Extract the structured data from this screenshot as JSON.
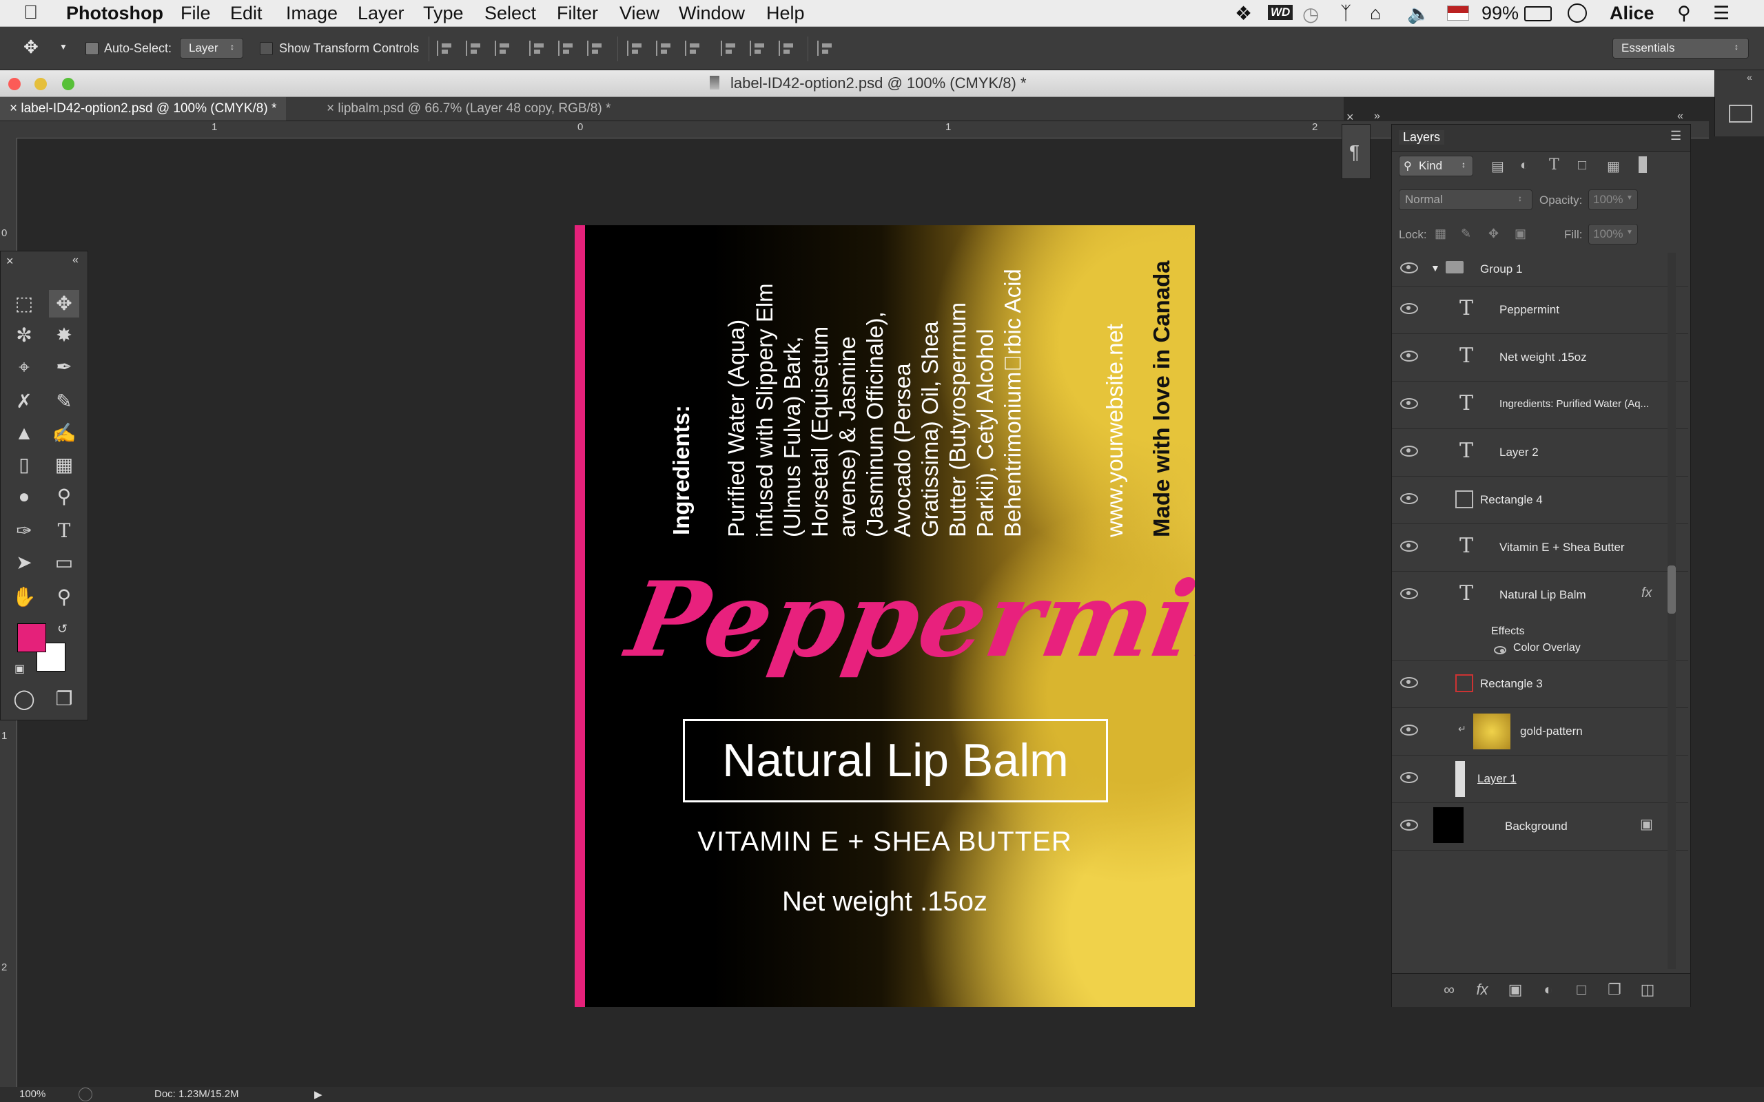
{
  "menubar": {
    "app": "Photoshop",
    "items": [
      "File",
      "Edit",
      "Image",
      "Layer",
      "Type",
      "Select",
      "Filter",
      "View",
      "Window",
      "Help"
    ],
    "wd_label": "WD",
    "battery": "99%",
    "user": "Alice"
  },
  "options": {
    "auto_select_label": "Auto-Select:",
    "auto_select_value": "Layer",
    "transform_label": "Show Transform Controls",
    "workspace": "Essentials"
  },
  "window": {
    "title": "label-ID42-option2.psd @ 100% (CMYK/8) *",
    "tabs": [
      "label-ID42-option2.psd @ 100% (CMYK/8) *",
      "lipbalm.psd @ 66.7% (Layer 48 copy, RGB/8) *"
    ]
  },
  "rulers": {
    "top": [
      "1",
      "0",
      "1",
      "2"
    ],
    "left": [
      "0",
      "1",
      "2"
    ]
  },
  "colors": {
    "foreground": "#e5217a",
    "background": "#ffffff"
  },
  "label": {
    "ingredients_heading": "Ingredients:",
    "ingredients_lines": [
      "Purified Water (Aqua)",
      "infused with Slippery Elm",
      "(Ulmus Fulva) Bark,",
      "Horsetail (Equisetum",
      "arvense) & Jasmine",
      "(Jasminum Officinale),",
      "Avocado (Persea",
      "Gratissima) Oil, Shea",
      "Butter (Butyrospermum",
      "Parkii), Cetyl Alcohol",
      "Behentrimonium\u0000rbic Acid"
    ],
    "website": "www.yourwebsite.net",
    "made_in": "Made with love in Canada",
    "flavor": "Peppermint",
    "product": "Natural Lip Balm",
    "subtitle": "VITAMIN E + SHEA BUTTER",
    "net_weight": "Net weight .15oz"
  },
  "layers": {
    "tab": "Layers",
    "filter_kind": "Kind",
    "blend_mode": "Normal",
    "opacity_label": "Opacity:",
    "opacity_value": "100%",
    "lock_label": "Lock:",
    "fill_label": "Fill:",
    "fill_value": "100%",
    "items": [
      {
        "name": "Group 1",
        "kind": "group"
      },
      {
        "name": "Peppermint",
        "kind": "text"
      },
      {
        "name": "Net weight .15oz",
        "kind": "text"
      },
      {
        "name": "Ingredients:  Purified Water (Aq...",
        "kind": "text"
      },
      {
        "name": "Layer 2",
        "kind": "text"
      },
      {
        "name": "Rectangle 4",
        "kind": "shape"
      },
      {
        "name": "Vitamin E + Shea Butter",
        "kind": "text"
      },
      {
        "name": "Natural Lip Balm",
        "kind": "text"
      },
      {
        "name": "Rectangle 3",
        "kind": "shape"
      },
      {
        "name": "gold-pattern",
        "kind": "pixel"
      },
      {
        "name": "Layer 1",
        "kind": "pixel"
      },
      {
        "name": "Background",
        "kind": "pixel"
      }
    ],
    "effects_label": "Effects",
    "effect_item": "Color Overlay"
  },
  "status": {
    "zoom": "100%",
    "doc": "Doc: 1.23M/15.2M"
  }
}
